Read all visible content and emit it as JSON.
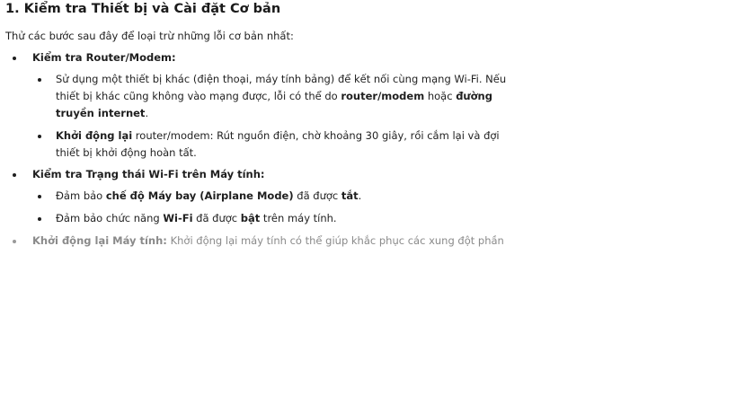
{
  "title": "1. Kiểm tra Thiết bị và Cài đặt Cơ bản",
  "intro": "Thử các bước sau đây để loại trừ những lỗi cơ bản nhất:",
  "router": {
    "heading": "Kiểm tra Router/Modem:",
    "sub1_l1": "Sử dụng một thiết bị khác (điện thoại, máy tính bảng) để kết nối cùng mạng Wi-Fi. Nếu",
    "sub1_l2_a": "thiết bị khác cũng không vào mạng được, lỗi có thể do ",
    "sub1_l2_b": "router/modem",
    "sub1_l2_c": " hoặc ",
    "sub1_l2_d": "đường",
    "sub1_l3": "truyền internet",
    "sub1_l3_end": ".",
    "sub2_l1_a": "Khởi động lại",
    "sub2_l1_b": " router/modem: Rút nguồn điện, chờ khoảng 30 giây, rồi cắm lại và đợi",
    "sub2_l2": "thiết bị khởi động hoàn tất."
  },
  "wifi": {
    "heading": "Kiểm tra Trạng thái Wi-Fi trên Máy tính:",
    "sub1_a": "Đảm bảo ",
    "sub1_b": "chế độ Máy bay (Airplane Mode)",
    "sub1_c": " đã được ",
    "sub1_d": "tắt",
    "sub1_e": ".",
    "sub2_a": "Đảm bảo chức năng ",
    "sub2_b": "Wi-Fi",
    "sub2_c": " đã được ",
    "sub2_d": "bật",
    "sub2_e": " trên máy tính."
  },
  "restart": {
    "heading": "Khởi động lại Máy tính:",
    "text": " Khởi động lại máy tính có thể giúp khắc phục các xung đột phần"
  }
}
